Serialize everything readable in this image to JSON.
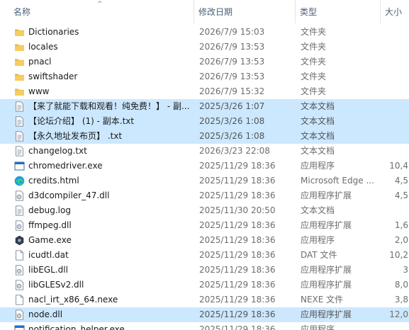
{
  "columns": {
    "name": "名称",
    "date": "修改日期",
    "type": "类型",
    "size": "大小"
  },
  "colors": {
    "selection": "#cce8ff",
    "folder": "#f2c55c",
    "header_text": "#4c607a"
  },
  "files": [
    {
      "name": "Dictionaries",
      "date": "2026/7/9 15:03",
      "type": "文件夹",
      "size": "",
      "icon": "folder-icon",
      "selected": false
    },
    {
      "name": "locales",
      "date": "2026/7/9 13:53",
      "type": "文件夹",
      "size": "",
      "icon": "folder-icon",
      "selected": false
    },
    {
      "name": "pnacl",
      "date": "2026/7/9 13:53",
      "type": "文件夹",
      "size": "",
      "icon": "folder-icon",
      "selected": false
    },
    {
      "name": "swiftshader",
      "date": "2026/7/9 13:53",
      "type": "文件夹",
      "size": "",
      "icon": "folder-icon",
      "selected": false
    },
    {
      "name": "www",
      "date": "2026/7/9 15:32",
      "type": "文件夹",
      "size": "",
      "icon": "folder-icon",
      "selected": false
    },
    {
      "name": "【来了就能下载和观看！纯免费！】 - 副...",
      "date": "2025/3/26 1:07",
      "type": "文本文档",
      "size": "",
      "icon": "text-file-icon",
      "selected": true
    },
    {
      "name": "【论坛介绍】 (1) - 副本.txt",
      "date": "2025/3/26 1:08",
      "type": "文本文档",
      "size": "",
      "icon": "text-file-icon",
      "selected": true
    },
    {
      "name": "【永久地址发布页】 .txt",
      "date": "2025/3/26 1:08",
      "type": "文本文档",
      "size": "",
      "icon": "text-file-icon",
      "selected": true
    },
    {
      "name": "changelog.txt",
      "date": "2026/3/23 22:08",
      "type": "文本文档",
      "size": "",
      "icon": "text-file-icon",
      "selected": false
    },
    {
      "name": "chromedriver.exe",
      "date": "2025/11/29 18:36",
      "type": "应用程序",
      "size": "10,4",
      "icon": "app-window-icon",
      "selected": false
    },
    {
      "name": "credits.html",
      "date": "2025/11/29 18:36",
      "type": "Microsoft Edge ...",
      "size": "4,5",
      "icon": "edge-icon",
      "selected": false
    },
    {
      "name": "d3dcompiler_47.dll",
      "date": "2025/11/29 18:36",
      "type": "应用程序扩展",
      "size": "4,5",
      "icon": "dll-file-icon",
      "selected": false
    },
    {
      "name": "debug.log",
      "date": "2025/11/30 20:50",
      "type": "文本文档",
      "size": "",
      "icon": "text-file-icon",
      "selected": false
    },
    {
      "name": "ffmpeg.dll",
      "date": "2025/11/29 18:36",
      "type": "应用程序扩展",
      "size": "1,6",
      "icon": "dll-file-icon",
      "selected": false
    },
    {
      "name": "Game.exe",
      "date": "2025/11/29 18:36",
      "type": "应用程序",
      "size": "2,0",
      "icon": "game-app-icon",
      "selected": false
    },
    {
      "name": "icudtl.dat",
      "date": "2025/11/29 18:36",
      "type": "DAT 文件",
      "size": "10,2",
      "icon": "blank-file-icon",
      "selected": false
    },
    {
      "name": "libEGL.dll",
      "date": "2025/11/29 18:36",
      "type": "应用程序扩展",
      "size": "3",
      "icon": "dll-file-icon",
      "selected": false
    },
    {
      "name": "libGLESv2.dll",
      "date": "2025/11/29 18:36",
      "type": "应用程序扩展",
      "size": "8,0",
      "icon": "dll-file-icon",
      "selected": false
    },
    {
      "name": "nacl_irt_x86_64.nexe",
      "date": "2025/11/29 18:36",
      "type": "NEXE 文件",
      "size": "3,8",
      "icon": "blank-file-icon",
      "selected": false
    },
    {
      "name": "node.dll",
      "date": "2025/11/29 18:36",
      "type": "应用程序扩展",
      "size": "12,0",
      "icon": "dll-file-icon",
      "selected": true
    },
    {
      "name": "notification_helper.exe",
      "date": "2025/11/29 18:36",
      "type": "应用程序",
      "size": "",
      "icon": "app-window-icon",
      "selected": false
    }
  ]
}
